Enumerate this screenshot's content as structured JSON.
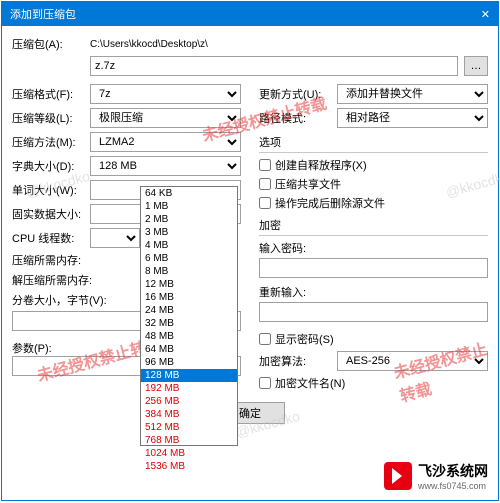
{
  "title": "添加到压缩包",
  "pathLabel": "压缩包(A):",
  "pathValue": "C:\\Users\\kkocd\\Desktop\\z\\",
  "fileValue": "z.7z",
  "left": {
    "formatLabel": "压缩格式(F):",
    "formatValue": "7z",
    "levelLabel": "压缩等级(L):",
    "levelValue": "极限压缩",
    "methodLabel": "压缩方法(M):",
    "methodValue": "LZMA2",
    "dictLabel": "字典大小(D):",
    "dictValue": "128 MB",
    "wordLabel": "单词大小(W):",
    "wordValue": "",
    "solidLabel": "固实数据大小:",
    "solidValue": "",
    "cpuLabel": "CPU 线程数:",
    "cpuValue": "",
    "memCompLabel": "压缩所需内存:",
    "memDecoLabel": "解压缩所需内存:",
    "splitLabel": "分卷大小，字节(V):",
    "paramLabel": "参数(P):"
  },
  "right": {
    "updateLabel": "更新方式(U):",
    "updateValue": "添加并替换文件",
    "pathModeLabel": "路径模式:",
    "pathModeValue": "相对路径",
    "optHeader": "选项",
    "optSfx": "创建自释放程序(X)",
    "optShare": "压缩共享文件",
    "optDelete": "操作完成后删除源文件",
    "encHeader": "加密",
    "pwd1Label": "输入密码:",
    "pwd2Label": "重新输入:",
    "showPwd": "显示密码(S)",
    "algoLabel": "加密算法:",
    "algoValue": "AES-256",
    "encNames": "加密文件名(N)"
  },
  "dictOptions": [
    "64 KB",
    "1 MB",
    "2 MB",
    "3 MB",
    "4 MB",
    "6 MB",
    "8 MB",
    "12 MB",
    "16 MB",
    "24 MB",
    "32 MB",
    "48 MB",
    "64 MB",
    "96 MB",
    "128 MB",
    "192 MB",
    "256 MB",
    "384 MB",
    "512 MB",
    "768 MB",
    "1024 MB",
    "1536 MB"
  ],
  "ok": "确定",
  "watermarkRed": "未经授权禁止转载",
  "watermarkGrey": "@kkocdko",
  "logo": {
    "cn": "飞沙系统网",
    "en": "www.fs0745.com"
  }
}
